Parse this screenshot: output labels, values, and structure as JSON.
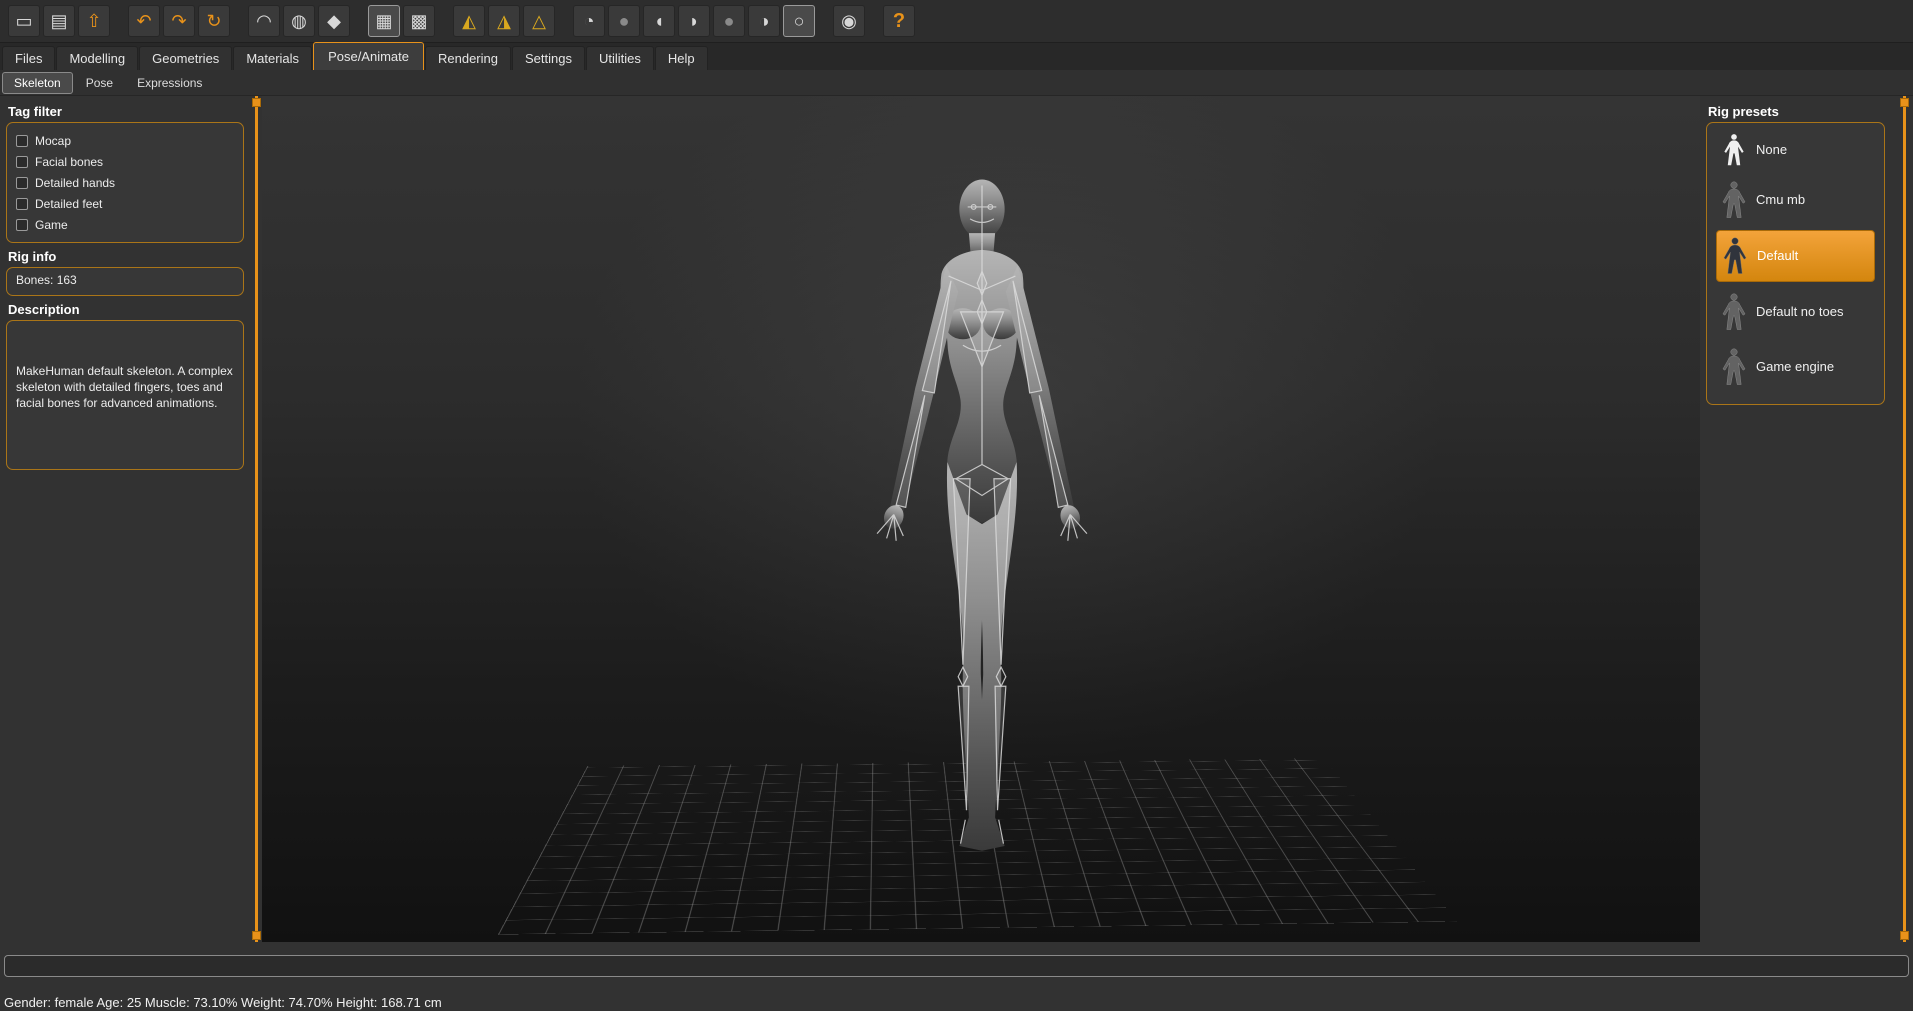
{
  "colors": {
    "accent": "#e8921a"
  },
  "toolbar": {
    "buttons": [
      {
        "name": "new-document-icon",
        "glyph": "▭"
      },
      {
        "name": "save-icon",
        "glyph": "▤"
      },
      {
        "name": "load-icon",
        "glyph": "⇧"
      },
      {
        "name": "undo-icon",
        "glyph": "↶"
      },
      {
        "name": "redo-icon",
        "glyph": "↷"
      },
      {
        "name": "reset-view-icon",
        "glyph": "↻"
      },
      {
        "name": "hand-icon",
        "glyph": "◠"
      },
      {
        "name": "wireframe-globe-icon",
        "glyph": "◍"
      },
      {
        "name": "skeleton-icon",
        "glyph": "◆"
      },
      {
        "name": "grid-icon",
        "glyph": "▦"
      },
      {
        "name": "checkerboard-icon",
        "glyph": "▩"
      },
      {
        "name": "symmetry-right-icon",
        "glyph": "◭"
      },
      {
        "name": "symmetry-left-icon",
        "glyph": "◮"
      },
      {
        "name": "symmetry-icon",
        "glyph": "△"
      },
      {
        "name": "face-view-icon",
        "glyph": "◔"
      },
      {
        "name": "head-top-icon",
        "glyph": "●"
      },
      {
        "name": "head-left-icon",
        "glyph": "◖"
      },
      {
        "name": "head-right-icon",
        "glyph": "◗"
      },
      {
        "name": "head-back-icon",
        "glyph": "●"
      },
      {
        "name": "head-half-icon",
        "glyph": "◑"
      },
      {
        "name": "orbit-view-icon",
        "glyph": "○"
      },
      {
        "name": "camera-icon",
        "glyph": "◉"
      },
      {
        "name": "help-icon",
        "glyph": "?"
      }
    ]
  },
  "tabs": [
    {
      "label": "Files"
    },
    {
      "label": "Modelling"
    },
    {
      "label": "Geometries"
    },
    {
      "label": "Materials"
    },
    {
      "label": "Pose/Animate",
      "active": true
    },
    {
      "label": "Rendering"
    },
    {
      "label": "Settings"
    },
    {
      "label": "Utilities"
    },
    {
      "label": "Help"
    }
  ],
  "subtabs": [
    {
      "label": "Skeleton",
      "active": true
    },
    {
      "label": "Pose"
    },
    {
      "label": "Expressions"
    }
  ],
  "left_panel": {
    "tag_filter": {
      "title": "Tag filter",
      "options": [
        {
          "label": "Mocap",
          "checked": false
        },
        {
          "label": "Facial bones",
          "checked": false
        },
        {
          "label": "Detailed hands",
          "checked": false
        },
        {
          "label": "Detailed feet",
          "checked": false
        },
        {
          "label": "Game",
          "checked": false
        }
      ]
    },
    "rig_info": {
      "title": "Rig info",
      "bones": "Bones: 163"
    },
    "description": {
      "title": "Description",
      "text": "MakeHuman default skeleton. A complex skeleton with detailed fingers, toes and facial bones for advanced animations."
    }
  },
  "right_panel": {
    "rig_presets": {
      "title": "Rig presets",
      "items": [
        {
          "label": "None",
          "selected": false
        },
        {
          "label": "Cmu mb",
          "selected": false
        },
        {
          "label": "Default",
          "selected": true
        },
        {
          "label": "Default no toes",
          "selected": false
        },
        {
          "label": "Game engine",
          "selected": false
        }
      ]
    }
  },
  "status_bar": {
    "text": "Gender: female Age: 25 Muscle: 73.10% Weight: 74.70% Height: 168.71 cm"
  }
}
